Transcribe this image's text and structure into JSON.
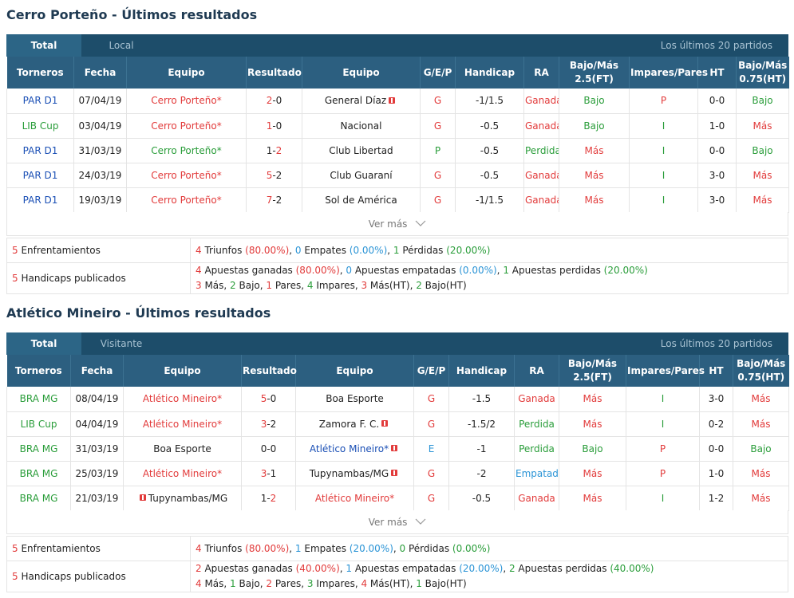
{
  "section1": {
    "title": "Cerro Porteño - Últimos resultados",
    "tab_active": "Total",
    "tab_inactive": "Local",
    "tab_right": "Los últimos 20 partidos",
    "headers": [
      "Torneros",
      "Fecha",
      "Equipo",
      "Resultado",
      "Equipo",
      "G/E/P",
      "Handicap",
      "RA",
      "Bajo/Más 2.5(FT)",
      "Impares/Pares",
      "HT",
      "Bajo/Más 0.75(HT)"
    ],
    "rows": [
      {
        "league": "PAR D1",
        "league_color": "blue",
        "date": "07/04/19",
        "home": "Cerro Porteño*",
        "home_color": "red",
        "home_flag": false,
        "score_h": "2",
        "score_a": "0",
        "score_h_color": "red",
        "score_a_color": "dark",
        "away": "General Díaz",
        "away_color": "dark",
        "away_flag": true,
        "gep": "G",
        "gep_color": "red",
        "handicap": "-1/1.5",
        "ra": "Ganada",
        "ra_color": "red",
        "ou": "Bajo",
        "ou_color": "green",
        "oe": "P",
        "oe_color": "red",
        "ht": "0-0",
        "ouht": "Bajo",
        "ouht_color": "green"
      },
      {
        "league": "LIB Cup",
        "league_color": "green",
        "date": "03/04/19",
        "home": "Cerro Porteño*",
        "home_color": "red",
        "home_flag": false,
        "score_h": "1",
        "score_a": "0",
        "score_h_color": "red",
        "score_a_color": "dark",
        "away": "Nacional",
        "away_color": "dark",
        "away_flag": false,
        "gep": "G",
        "gep_color": "red",
        "handicap": "-0.5",
        "ra": "Ganada",
        "ra_color": "red",
        "ou": "Bajo",
        "ou_color": "green",
        "oe": "I",
        "oe_color": "green",
        "ht": "1-0",
        "ouht": "Más",
        "ouht_color": "red"
      },
      {
        "league": "PAR D1",
        "league_color": "blue",
        "date": "31/03/19",
        "home": "Cerro Porteño*",
        "home_color": "green",
        "home_flag": false,
        "score_h": "1",
        "score_a": "2",
        "score_h_color": "dark",
        "score_a_color": "red",
        "away": "Club Libertad",
        "away_color": "dark",
        "away_flag": false,
        "gep": "P",
        "gep_color": "green",
        "handicap": "-0.5",
        "ra": "Perdida",
        "ra_color": "green",
        "ou": "Más",
        "ou_color": "red",
        "oe": "I",
        "oe_color": "green",
        "ht": "0-0",
        "ouht": "Bajo",
        "ouht_color": "green"
      },
      {
        "league": "PAR D1",
        "league_color": "blue",
        "date": "24/03/19",
        "home": "Cerro Porteño*",
        "home_color": "red",
        "home_flag": false,
        "score_h": "5",
        "score_a": "2",
        "score_h_color": "red",
        "score_a_color": "dark",
        "away": "Club Guaraní",
        "away_color": "dark",
        "away_flag": false,
        "gep": "G",
        "gep_color": "red",
        "handicap": "-0.5",
        "ra": "Ganada",
        "ra_color": "red",
        "ou": "Más",
        "ou_color": "red",
        "oe": "I",
        "oe_color": "green",
        "ht": "3-0",
        "ouht": "Más",
        "ouht_color": "red"
      },
      {
        "league": "PAR D1",
        "league_color": "blue",
        "date": "19/03/19",
        "home": "Cerro Porteño*",
        "home_color": "red",
        "home_flag": false,
        "score_h": "7",
        "score_a": "2",
        "score_h_color": "red",
        "score_a_color": "dark",
        "away": "Sol de América",
        "away_color": "dark",
        "away_flag": false,
        "gep": "G",
        "gep_color": "red",
        "handicap": "-1/1.5",
        "ra": "Ganada",
        "ra_color": "red",
        "ou": "Más",
        "ou_color": "red",
        "oe": "I",
        "oe_color": "green",
        "ht": "3-0",
        "ouht": "Más",
        "ouht_color": "red"
      }
    ],
    "more": "Ver más",
    "summary": {
      "matches_count": "5",
      "matches_label": " Enfrentamientos",
      "wins": "4",
      "wins_label": " Triunfos ",
      "wins_pct": "(80.00%)",
      "draws": "0",
      "draws_label": " Empates ",
      "draws_pct": "(0.00%)",
      "losses": "1",
      "losses_label": " Pérdidas ",
      "losses_pct": "(20.00%)",
      "hc_count": "5",
      "hc_label": " Handicaps publicados",
      "hw": "4",
      "hw_label": " Apuestas ganadas ",
      "hw_pct": "(80.00%)",
      "hd": "0",
      "hd_label": " Apuestas empatadas ",
      "hd_pct": "(0.00%)",
      "hl": "1",
      "hl_label": " Apuestas perdidas ",
      "hl_pct": "(20.00%)",
      "over": "3",
      "over_label": " Más, ",
      "under": "2",
      "under_label": " Bajo, ",
      "even": "1",
      "even_label": " Pares, ",
      "odd": "4",
      "odd_label": " Impares, ",
      "overht": "3",
      "overht_label": " Más(HT), ",
      "underht": "2",
      "underht_label": " Bajo(HT)"
    }
  },
  "section2": {
    "title": "Atlético Mineiro - Últimos resultados",
    "tab_active": "Total",
    "tab_inactive": "Visitante",
    "tab_right": "Los últimos 20 partidos",
    "headers": [
      "Torneros",
      "Fecha",
      "Equipo",
      "Resultado",
      "Equipo",
      "G/E/P",
      "Handicap",
      "RA",
      "Bajo/Más 2.5(FT)",
      "Impares/Pares",
      "HT",
      "Bajo/Más 0.75(HT)"
    ],
    "rows": [
      {
        "league": "BRA MG",
        "league_color": "green",
        "date": "08/04/19",
        "home": "Atlético Mineiro*",
        "home_color": "red",
        "home_flag": false,
        "score_h": "5",
        "score_a": "0",
        "score_h_color": "red",
        "score_a_color": "dark",
        "away": "Boa Esporte",
        "away_color": "dark",
        "away_flag": false,
        "gep": "G",
        "gep_color": "red",
        "handicap": "-1.5",
        "ra": "Ganada",
        "ra_color": "red",
        "ou": "Más",
        "ou_color": "red",
        "oe": "I",
        "oe_color": "green",
        "ht": "3-0",
        "ouht": "Más",
        "ouht_color": "red"
      },
      {
        "league": "LIB Cup",
        "league_color": "green",
        "date": "04/04/19",
        "home": "Atlético Mineiro*",
        "home_color": "red",
        "home_flag": false,
        "score_h": "3",
        "score_a": "2",
        "score_h_color": "red",
        "score_a_color": "dark",
        "away": "Zamora F. C.",
        "away_color": "dark",
        "away_flag": true,
        "gep": "G",
        "gep_color": "red",
        "handicap": "-1.5/2",
        "ra": "Perdida",
        "ra_color": "green",
        "ou": "Más",
        "ou_color": "red",
        "oe": "I",
        "oe_color": "green",
        "ht": "0-2",
        "ouht": "Más",
        "ouht_color": "red"
      },
      {
        "league": "BRA MG",
        "league_color": "green",
        "date": "31/03/19",
        "home": "Boa Esporte",
        "home_color": "dark",
        "home_flag": false,
        "score_h": "0",
        "score_a": "0",
        "score_h_color": "dark",
        "score_a_color": "dark",
        "away": "Atlético Mineiro*",
        "away_color": "blue",
        "away_flag": true,
        "gep": "E",
        "gep_color": "lblue",
        "handicap": "-1",
        "ra": "Perdida",
        "ra_color": "green",
        "ou": "Bajo",
        "ou_color": "green",
        "oe": "P",
        "oe_color": "red",
        "ht": "0-0",
        "ouht": "Bajo",
        "ouht_color": "green"
      },
      {
        "league": "BRA MG",
        "league_color": "green",
        "date": "25/03/19",
        "home": "Atlético Mineiro*",
        "home_color": "red",
        "home_flag": false,
        "score_h": "3",
        "score_a": "1",
        "score_h_color": "red",
        "score_a_color": "dark",
        "away": "Tupynambas/MG",
        "away_color": "dark",
        "away_flag": true,
        "gep": "G",
        "gep_color": "red",
        "handicap": "-2",
        "ra": "Empatada",
        "ra_color": "lblue",
        "ou": "Más",
        "ou_color": "red",
        "oe": "P",
        "oe_color": "red",
        "ht": "1-0",
        "ouht": "Más",
        "ouht_color": "red"
      },
      {
        "league": "BRA MG",
        "league_color": "green",
        "date": "21/03/19",
        "home": "Tupynambas/MG",
        "home_color": "dark",
        "home_flag": true,
        "score_h": "1",
        "score_a": "2",
        "score_h_color": "dark",
        "score_a_color": "red",
        "away": "Atlético Mineiro*",
        "away_color": "red",
        "away_flag": false,
        "gep": "G",
        "gep_color": "red",
        "handicap": "-0.5",
        "ra": "Ganada",
        "ra_color": "red",
        "ou": "Más",
        "ou_color": "red",
        "oe": "I",
        "oe_color": "green",
        "ht": "1-2",
        "ouht": "Más",
        "ouht_color": "red"
      }
    ],
    "more": "Ver más",
    "summary": {
      "matches_count": "5",
      "matches_label": " Enfrentamientos",
      "wins": "4",
      "wins_label": " Triunfos ",
      "wins_pct": "(80.00%)",
      "draws": "1",
      "draws_label": " Empates ",
      "draws_pct": "(20.00%)",
      "losses": "0",
      "losses_label": " Pérdidas ",
      "losses_pct": "(0.00%)",
      "hc_count": "5",
      "hc_label": " Handicaps publicados",
      "hw": "2",
      "hw_label": " Apuestas ganadas ",
      "hw_pct": "(40.00%)",
      "hd": "1",
      "hd_label": " Apuestas empatadas ",
      "hd_pct": "(20.00%)",
      "hl": "2",
      "hl_label": " Apuestas perdidas ",
      "hl_pct": "(40.00%)",
      "over": "4",
      "over_label": " Más, ",
      "under": "1",
      "under_label": " Bajo, ",
      "even": "2",
      "even_label": " Pares, ",
      "odd": "3",
      "odd_label": " Impares, ",
      "overht": "4",
      "overht_label": " Más(HT), ",
      "underht": "1",
      "underht_label": " Bajo(HT)"
    }
  },
  "colors": {
    "blue": "#1a4fb5",
    "green": "#2a9d3a",
    "red": "#e23b3b",
    "dark": "#222222",
    "lblue": "#2b94d6",
    "header_bg": "#2c5f80",
    "tabbar_bg": "#1d4d6a"
  }
}
